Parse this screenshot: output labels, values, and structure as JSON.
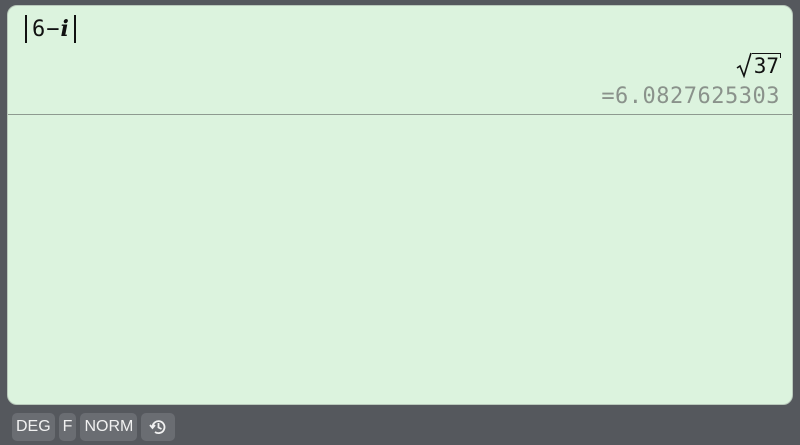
{
  "expression": {
    "number": "6",
    "operator": "−",
    "imaginary": "i"
  },
  "result": {
    "exact_radicand": "37",
    "decimal": "=6.0827625303"
  },
  "statusbar": {
    "angle_mode": "DEG",
    "format_mode": "F",
    "display_mode": "NORM",
    "history_icon": "history-icon"
  },
  "colors": {
    "screen_bg": "#dcf3de",
    "frame_bg": "#55585d",
    "chip_bg": "#6a6d72",
    "decimal_text": "#8a928b"
  }
}
